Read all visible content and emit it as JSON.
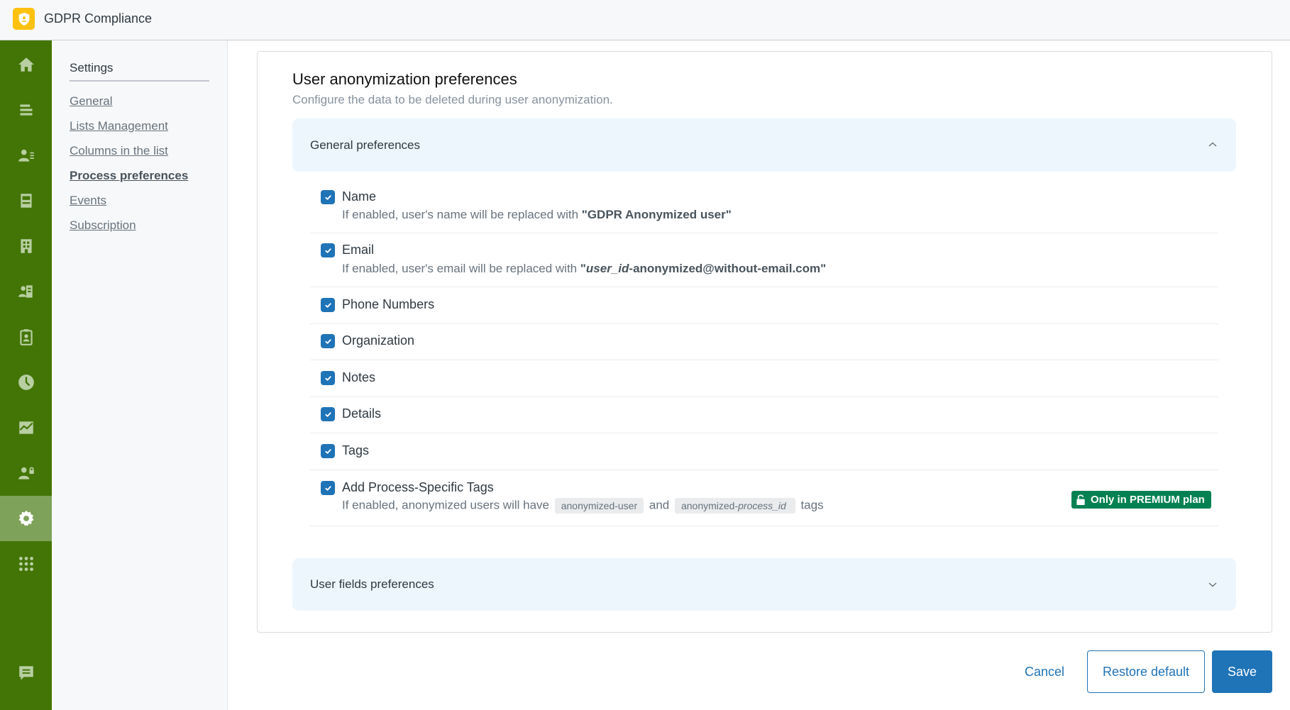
{
  "app": {
    "title": "GDPR Compliance",
    "logo_icon": "shield-user-icon",
    "brand_color": "#fec10f",
    "rail_color": "#437506"
  },
  "rail": {
    "items": [
      {
        "name": "home",
        "icon": "home-icon",
        "active": false
      },
      {
        "name": "views",
        "icon": "views-icon",
        "active": false
      },
      {
        "name": "customers",
        "icon": "customer-list-icon",
        "active": false
      },
      {
        "name": "inbox",
        "icon": "inbox-icon",
        "active": false
      },
      {
        "name": "organizations",
        "icon": "building-icon",
        "active": false
      },
      {
        "name": "user-lookup",
        "icon": "user-book-icon",
        "active": false
      },
      {
        "name": "user-badge",
        "icon": "user-badge-icon",
        "active": false
      },
      {
        "name": "history",
        "icon": "clock-icon",
        "active": false
      },
      {
        "name": "reporting",
        "icon": "chart-icon",
        "active": false
      },
      {
        "name": "user-lock",
        "icon": "user-lock-icon",
        "active": false
      },
      {
        "name": "settings",
        "icon": "gear-icon",
        "active": true
      },
      {
        "name": "apps",
        "icon": "grid-icon",
        "active": false
      },
      {
        "name": "feedback",
        "icon": "chat-icon",
        "active": false
      }
    ]
  },
  "subnav": {
    "title": "Settings",
    "items": [
      {
        "label": "General",
        "active": false
      },
      {
        "label": "Lists Management",
        "active": false
      },
      {
        "label": "Columns in the list",
        "active": false
      },
      {
        "label": "Process preferences",
        "active": true
      },
      {
        "label": "Events",
        "active": false
      },
      {
        "label": "Subscription",
        "active": false
      }
    ]
  },
  "main": {
    "title": "User anonymization preferences",
    "subtitle": "Configure the data to be deleted during user anonymization.",
    "general_section": {
      "label": "General preferences",
      "expanded": true,
      "rows": [
        {
          "label": "Name",
          "checked": true,
          "desc_prefix": "If enabled, user's name will be replaced with ",
          "desc_value": "\"GDPR Anonymized user\""
        },
        {
          "label": "Email",
          "checked": true,
          "desc_prefix": "If enabled, user's email will be replaced with ",
          "desc_quote_open": "\"",
          "desc_value_italic": "user_id",
          "desc_value_rest": "-anonymized@without-email.com\""
        },
        {
          "label": "Phone Numbers",
          "checked": true
        },
        {
          "label": "Organization",
          "checked": true
        },
        {
          "label": "Notes",
          "checked": true
        },
        {
          "label": "Details",
          "checked": true
        },
        {
          "label": "Tags",
          "checked": true
        },
        {
          "label": "Add Process-Specific Tags",
          "checked": true,
          "desc_prefix": "If enabled, anonymized users will have",
          "tag1": "anonymized-user",
          "desc_and": "and",
          "tag2_prefix": "anonymized-",
          "tag2_italic": "process_id",
          "desc_suffix": "tags",
          "badge": "Only in PREMIUM plan",
          "badge_icon": "lock-open-icon",
          "badge_color": "#038153"
        }
      ]
    },
    "user_fields_section": {
      "label": "User fields preferences",
      "expanded": false
    }
  },
  "footer": {
    "cancel_label": "Cancel",
    "restore_label": "Restore default",
    "save_label": "Save",
    "primary_color": "#1f73b7"
  }
}
